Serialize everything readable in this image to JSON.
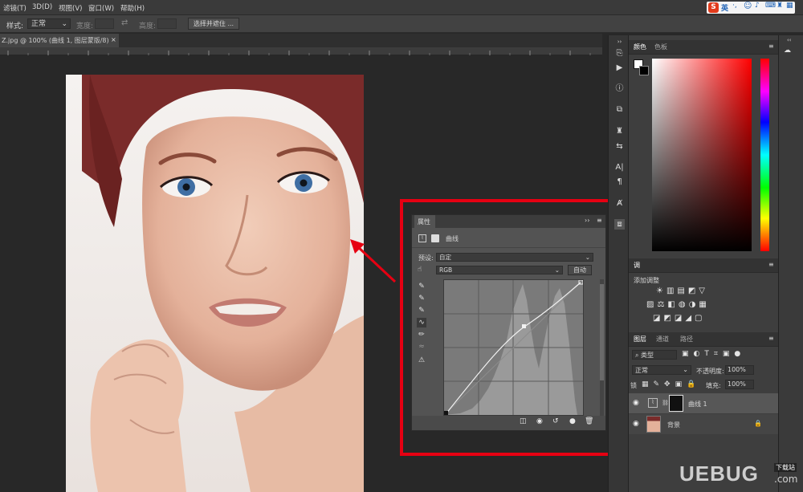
{
  "menu": [
    "滤镜(T)",
    "3D(D)",
    "视图(V)",
    "窗口(W)",
    "帮助(H)"
  ],
  "options": {
    "style_label": "样式:",
    "style_value": "正常",
    "width_label": "宽度:",
    "height_label": "高度:",
    "select_mask_button": "选择并遮住 ..."
  },
  "document_tab": "Z.jpg @ 100% (曲线 1, 图层蒙版/8) *",
  "color_panel": {
    "tabs": [
      "颜色",
      "色板"
    ]
  },
  "adjust_panel": {
    "tab": "调",
    "title": "添加调整"
  },
  "layers_panel": {
    "tabs": [
      "图层",
      "通道",
      "路径"
    ],
    "filter_kind": "类型",
    "blend_mode": "正常",
    "opacity_label": "不透明度:",
    "opacity_value": "100%",
    "lock_label": "锁",
    "fill_label": "填充:",
    "fill_value": "100%",
    "layers": [
      {
        "name": "曲线 1",
        "selected": true
      },
      {
        "name": "背景",
        "selected": false
      }
    ]
  },
  "properties": {
    "title": "属性",
    "panel_name": "曲线",
    "preset_label": "预设:",
    "preset_value": "自定",
    "channel_value": "RGB",
    "auto_button": "自动"
  },
  "ime": {
    "lang": "英"
  },
  "watermark": {
    "text": "UEBUG",
    "suffix": ".com",
    "tag": "下载站"
  },
  "colors": {
    "accent_red": "#e60012",
    "panel_bg": "#535353",
    "ui_dark": "#282828"
  }
}
